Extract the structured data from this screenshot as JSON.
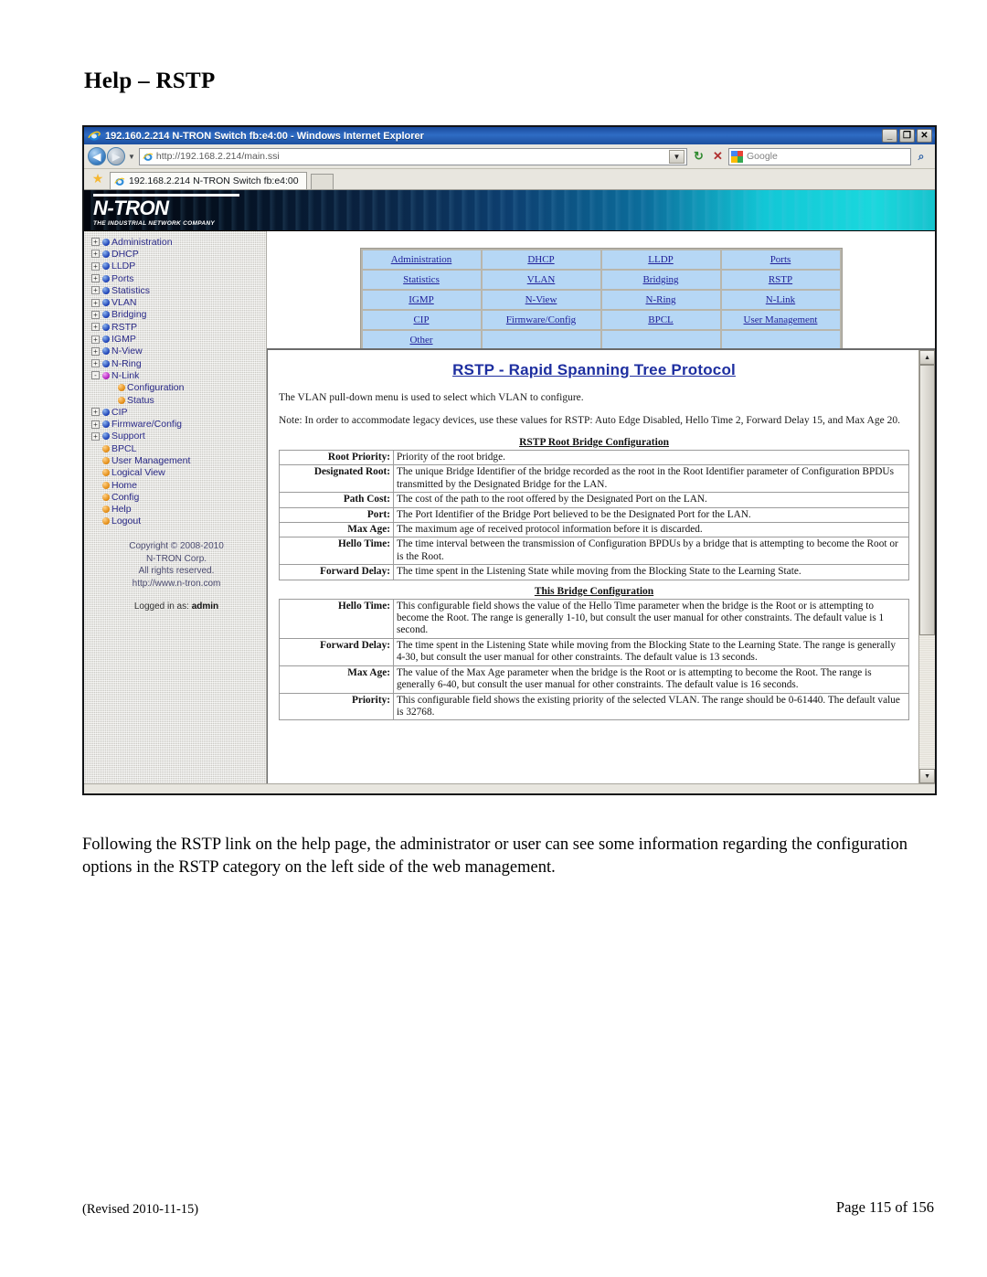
{
  "document": {
    "title": "Help – RSTP",
    "body_paragraph": "Following the RSTP link on the help page, the administrator or user can see some information regarding the configuration options in the RSTP category on the left side of the web management.",
    "footer_left": "(Revised 2010-11-15)",
    "footer_right": "Page 115 of 156"
  },
  "browser": {
    "window_title": "192.160.2.214 N-TRON Switch fb:e4:00 - Windows Internet Explorer",
    "window_buttons": {
      "minimize": "_",
      "maximize": "❐",
      "close": "✕"
    },
    "back_glyph": "◀",
    "forward_glyph": "▶",
    "history_caret": "▼",
    "address": {
      "value": "http://192.168.2.214/main.ssi",
      "go_glyph": "▼"
    },
    "refresh_glyph": "↻",
    "stop_glyph": "✕",
    "search": {
      "provider": "Google",
      "placeholder": "Google",
      "magnifier_glyph": "⌕",
      "dropdown_glyph": "▾"
    },
    "tab": {
      "label": "192.168.2.214 N-TRON Switch fb:e4:00",
      "favorites_glyph": "★"
    }
  },
  "banner": {
    "logo_main": "N-TRON",
    "logo_tagline": "THE INDUSTRIAL NETWORK COMPANY"
  },
  "sidebar": {
    "items": [
      {
        "label": "Administration",
        "expander": "+",
        "dot": "blue",
        "child": false
      },
      {
        "label": "DHCP",
        "expander": "+",
        "dot": "blue",
        "child": false
      },
      {
        "label": "LLDP",
        "expander": "+",
        "dot": "blue",
        "child": false
      },
      {
        "label": "Ports",
        "expander": "+",
        "dot": "blue",
        "child": false
      },
      {
        "label": "Statistics",
        "expander": "+",
        "dot": "blue",
        "child": false
      },
      {
        "label": "VLAN",
        "expander": "+",
        "dot": "blue",
        "child": false
      },
      {
        "label": "Bridging",
        "expander": "+",
        "dot": "blue",
        "child": false
      },
      {
        "label": "RSTP",
        "expander": "+",
        "dot": "blue",
        "child": false
      },
      {
        "label": "IGMP",
        "expander": "+",
        "dot": "blue",
        "child": false
      },
      {
        "label": "N-View",
        "expander": "+",
        "dot": "blue",
        "child": false
      },
      {
        "label": "N-Ring",
        "expander": "+",
        "dot": "blue",
        "child": false
      },
      {
        "label": "N-Link",
        "expander": "-",
        "dot": "magenta",
        "child": false
      },
      {
        "label": "Configuration",
        "expander": "",
        "dot": "orange",
        "child": true
      },
      {
        "label": "Status",
        "expander": "",
        "dot": "orange",
        "child": true
      },
      {
        "label": "CIP",
        "expander": "+",
        "dot": "blue",
        "child": false
      },
      {
        "label": "Firmware/Config",
        "expander": "+",
        "dot": "blue",
        "child": false
      },
      {
        "label": "Support",
        "expander": "+",
        "dot": "blue",
        "child": false
      },
      {
        "label": "BPCL",
        "expander": "",
        "dot": "orange",
        "child": false
      },
      {
        "label": "User Management",
        "expander": "",
        "dot": "orange",
        "child": false
      },
      {
        "label": "Logical View",
        "expander": "",
        "dot": "orange",
        "child": false
      },
      {
        "label": "Home",
        "expander": "",
        "dot": "orange",
        "child": false
      },
      {
        "label": "Config",
        "expander": "",
        "dot": "orange",
        "child": false
      },
      {
        "label": "Help",
        "expander": "",
        "dot": "orange",
        "child": false
      },
      {
        "label": "Logout",
        "expander": "",
        "dot": "orange",
        "child": false
      }
    ],
    "copyright_lines": [
      "Copyright © 2008-2010",
      "N-TRON Corp.",
      "All rights reserved.",
      "http://www.n-tron.com"
    ],
    "logged_in_prefix": "Logged in as:",
    "logged_in_user": "admin"
  },
  "nav_table": {
    "rows": [
      [
        "Administration",
        "DHCP",
        "LLDP",
        "Ports"
      ],
      [
        "Statistics",
        "VLAN",
        "Bridging",
        "RSTP"
      ],
      [
        "IGMP",
        "N-View",
        "N-Ring",
        "N-Link"
      ],
      [
        "CIP",
        "Firmware/Config",
        "BPCL",
        "User Management"
      ],
      [
        "Other",
        "",
        "",
        ""
      ]
    ]
  },
  "help": {
    "heading": "RSTP - Rapid Spanning Tree Protocol",
    "paragraphs": [
      "The VLAN pull-down menu is used to select which VLAN to configure.",
      "Note: In order to accommodate legacy devices, use these values for RSTP: Auto Edge Disabled, Hello Time 2, Forward Delay 15, and Max Age 20."
    ],
    "section1": {
      "title": "RSTP Root Bridge Configuration",
      "rows": [
        {
          "label": "Root Priority:",
          "desc": "Priority of the root bridge."
        },
        {
          "label": "Designated Root:",
          "desc": "The unique Bridge Identifier of the bridge recorded as the root in the Root Identifier parameter of Configuration BPDUs transmitted by the Designated Bridge for the LAN."
        },
        {
          "label": "Path Cost:",
          "desc": "The cost of the path to the root offered by the Designated Port on the LAN."
        },
        {
          "label": "Port:",
          "desc": "The Port Identifier of the Bridge Port believed to be the Designated Port for the LAN."
        },
        {
          "label": "Max Age:",
          "desc": "The maximum age of received protocol information before it is discarded."
        },
        {
          "label": "Hello Time:",
          "desc": "The time interval between the transmission of Configuration BPDUs by a bridge that is attempting to become the Root or is the Root."
        },
        {
          "label": "Forward Delay:",
          "desc": "The time spent in the Listening State while moving from the Blocking State to the Learning State."
        }
      ]
    },
    "section2": {
      "title": "This Bridge Configuration",
      "rows": [
        {
          "label": "Hello Time:",
          "desc": "This configurable field shows the value of the Hello Time parameter when the bridge is the Root or is attempting to become the Root. The range is generally 1-10, but consult the user manual for other constraints. The default value is 1 second."
        },
        {
          "label": "Forward Delay:",
          "desc": "The time spent in the Listening State while moving from the Blocking State to the Learning State. The range is generally 4-30, but consult the user manual for other constraints. The default value is 13 seconds."
        },
        {
          "label": "Max Age:",
          "desc": "The value of the Max Age parameter when the bridge is the Root or is attempting to become the Root. The range is generally 6-40, but consult the user manual for other constraints. The default value is 16 seconds."
        },
        {
          "label": "Priority:",
          "desc": "This configurable field shows the existing priority of the selected VLAN. The range should be 0-61440. The default value is 32768."
        }
      ]
    },
    "scrollbar": {
      "up_glyph": "▲",
      "down_glyph": "▼"
    }
  },
  "colors": {
    "accent_blue": "#1e2fa0",
    "nav_cell_bg": "#b6d7f5",
    "link": "#20209a",
    "tree_text": "#2a2a88"
  }
}
